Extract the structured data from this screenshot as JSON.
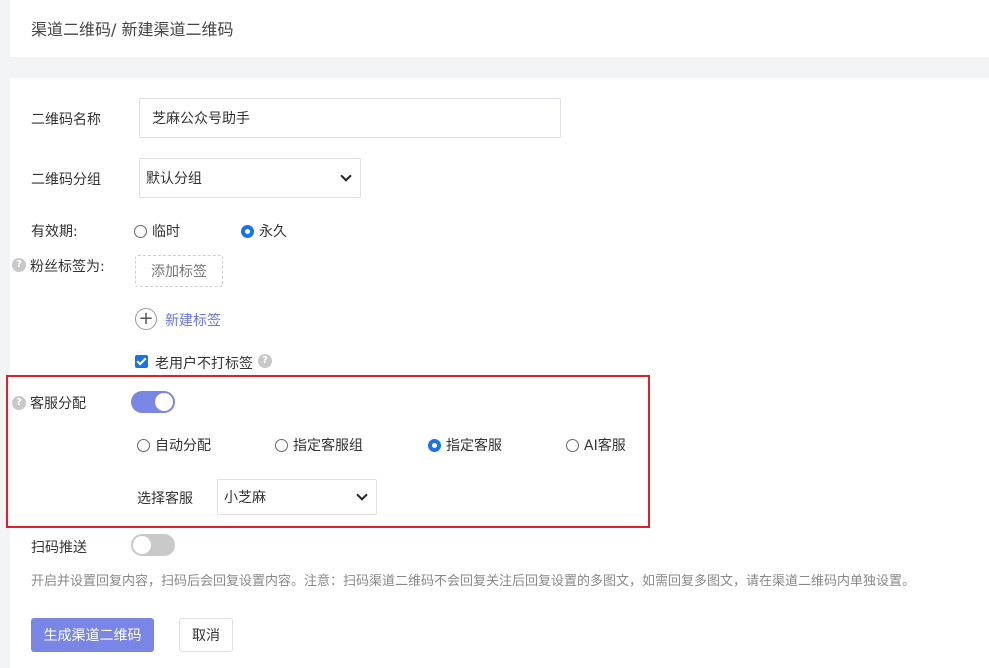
{
  "breadcrumb": {
    "parent": "渠道二维码/",
    "current": "新建渠道二维码"
  },
  "form": {
    "name": {
      "label": "二维码名称",
      "value": "芝麻公众号助手"
    },
    "group": {
      "label": "二维码分组",
      "selected": "默认分组"
    },
    "validity": {
      "label": "有效期:",
      "options": [
        "临时",
        "永久"
      ],
      "selected": "永久"
    },
    "fan_tag": {
      "label": "粉丝标签为:",
      "add_tag": "添加标签",
      "new_tag": "新建标签",
      "old_user_checkbox": "老用户不打标签",
      "old_user_checked": true
    },
    "service_assign": {
      "label": "客服分配",
      "enabled": true,
      "options": [
        "自动分配",
        "指定客服组",
        "指定客服",
        "AI客服"
      ],
      "selected": "指定客服",
      "select_label": "选择客服",
      "select_value": "小芝麻"
    },
    "scan_push": {
      "label": "扫码推送",
      "enabled": false,
      "hint": "开启并设置回复内容，扫码后会回复设置内容。注意：扫码渠道二维码不会回复关注后回复设置的多图文，如需回复多图文，请在渠道二维码内单独设置。"
    }
  },
  "actions": {
    "submit": "生成渠道二维码",
    "cancel": "取消"
  },
  "icons": {
    "help": "question-circle-icon",
    "add": "plus-circle-icon",
    "dropdown": "chevron-down-icon"
  },
  "colors": {
    "accent": "#7a86e6",
    "radio_checked": "#1a73e8",
    "highlight_border": "#d9232d"
  }
}
